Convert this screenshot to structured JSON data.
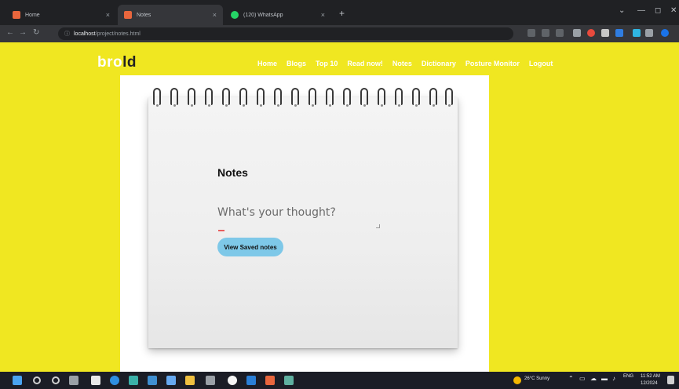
{
  "browser": {
    "tabs": [
      {
        "title": "Home",
        "favicon_color": "#e8663d"
      },
      {
        "title": "Notes",
        "favicon_color": "#e8663d"
      },
      {
        "title": "(120) WhatsApp",
        "favicon_color": "#25d366"
      }
    ],
    "close_glyph": "×",
    "new_tab_glyph": "+",
    "url_host": "localhost",
    "url_path": "/project/notes.html"
  },
  "site": {
    "logo_part1": "bro",
    "logo_part2": "ld",
    "nav": [
      "Home",
      "Blogs",
      "Top 10",
      "Read now!",
      "Notes",
      "Dictionary",
      "Posture Monitor",
      "Logout"
    ]
  },
  "notes": {
    "title": "Notes",
    "placeholder": "What's your thought?",
    "saved_button_label": "View Saved notes"
  },
  "taskbar": {
    "weather": "26°C Sunny",
    "lang": "ENG",
    "time": "11:52 AM",
    "date": "12/2024"
  },
  "colors": {
    "page_bg": "#f0e721",
    "button_bg": "#7ec8e8"
  }
}
